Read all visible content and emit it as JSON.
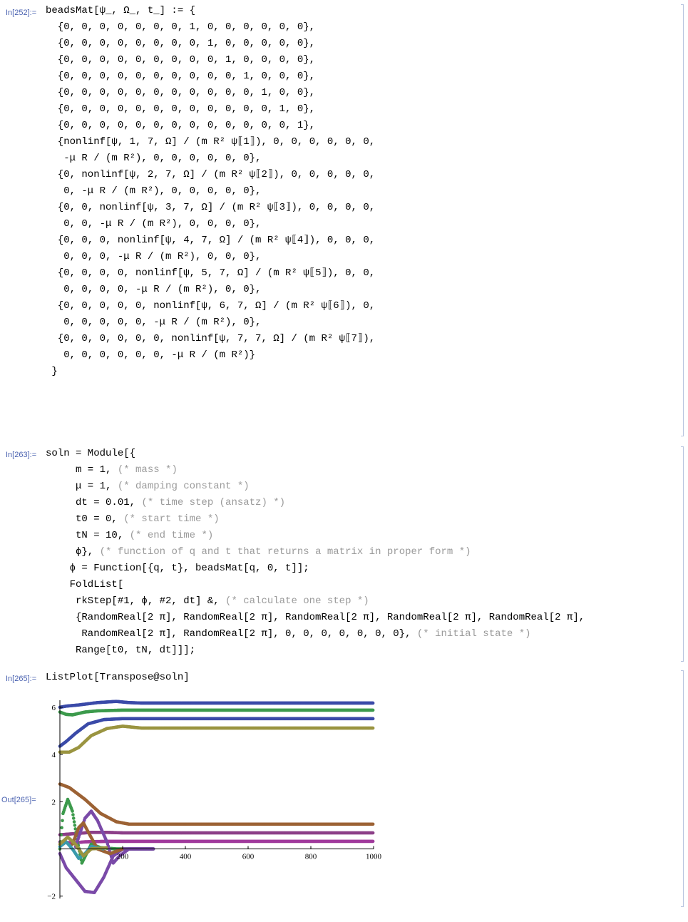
{
  "cells": [
    {
      "label": "In[252]:=",
      "lines": [
        "beadsMat[ψ_, Ω_, t_] := {",
        "  {0, 0, 0, 0, 0, 0, 0, 1, 0, 0, 0, 0, 0, 0},",
        "  {0, 0, 0, 0, 0, 0, 0, 0, 1, 0, 0, 0, 0, 0},",
        "  {0, 0, 0, 0, 0, 0, 0, 0, 0, 1, 0, 0, 0, 0},",
        "  {0, 0, 0, 0, 0, 0, 0, 0, 0, 0, 1, 0, 0, 0},",
        "  {0, 0, 0, 0, 0, 0, 0, 0, 0, 0, 0, 1, 0, 0},",
        "  {0, 0, 0, 0, 0, 0, 0, 0, 0, 0, 0, 0, 1, 0},",
        "  {0, 0, 0, 0, 0, 0, 0, 0, 0, 0, 0, 0, 0, 1},",
        "  {nonlinf[ψ, 1, 7, Ω] / (m R² ψ⟦1⟧), 0, 0, 0, 0, 0, 0,",
        "   -μ R / (m R²), 0, 0, 0, 0, 0, 0},",
        "  {0, nonlinf[ψ, 2, 7, Ω] / (m R² ψ⟦2⟧), 0, 0, 0, 0, 0,",
        "   0, -μ R / (m R²), 0, 0, 0, 0, 0},",
        "  {0, 0, nonlinf[ψ, 3, 7, Ω] / (m R² ψ⟦3⟧), 0, 0, 0, 0,",
        "   0, 0, -μ R / (m R²), 0, 0, 0, 0},",
        "  {0, 0, 0, nonlinf[ψ, 4, 7, Ω] / (m R² ψ⟦4⟧), 0, 0, 0,",
        "   0, 0, 0, -μ R / (m R²), 0, 0, 0},",
        "  {0, 0, 0, 0, nonlinf[ψ, 5, 7, Ω] / (m R² ψ⟦5⟧), 0, 0,",
        "   0, 0, 0, 0, -μ R / (m R²), 0, 0},",
        "  {0, 0, 0, 0, 0, nonlinf[ψ, 6, 7, Ω] / (m R² ψ⟦6⟧), 0,",
        "   0, 0, 0, 0, 0, -μ R / (m R²), 0},",
        "  {0, 0, 0, 0, 0, 0, nonlinf[ψ, 7, 7, Ω] / (m R² ψ⟦7⟧),",
        "   0, 0, 0, 0, 0, 0, -μ R / (m R²)}",
        " }"
      ]
    },
    {
      "label": "In[263]:=",
      "lines": [
        "soln = Module[{",
        "     m = 1, (* mass *)",
        "     μ = 1, (* damping constant *)",
        "     dt = 0.01, (* time step (ansatz) *)",
        "     t0 = 0, (* start time *)",
        "     tN = 10, (* end time *)",
        "     ϕ}, (* function of q and t that returns a matrix in proper form *)",
        "    ϕ = Function[{q, t}, beadsMat[q, 0, t]];",
        "    FoldList[",
        "     rkStep[#1, ϕ, #2, dt] &, (* calculate one step *)",
        "     {RandomReal[2 π], RandomReal[2 π], RandomReal[2 π], RandomReal[2 π], RandomReal[2 π],",
        "      RandomReal[2 π], RandomReal[2 π], 0, 0, 0, 0, 0, 0, 0}, (* initial state *)",
        "     Range[t0, tN, dt]]];"
      ]
    },
    {
      "label": "In[265]:=",
      "lines": [
        "ListPlot[Transpose@soln]"
      ]
    }
  ],
  "output_label": "Out[265]=",
  "chart_data": {
    "type": "scatter",
    "title": "",
    "xlabel": "",
    "ylabel": "",
    "xlim": [
      0,
      1000
    ],
    "ylim": [
      -2.1,
      6.3
    ],
    "x_ticks": [
      200,
      400,
      600,
      800,
      1000
    ],
    "y_ticks": [
      -2,
      2,
      4,
      6
    ],
    "x_tick_labels": [
      "200",
      "400",
      "600",
      "800",
      "1000"
    ],
    "y_tick_labels": [
      "−2",
      "2",
      "4",
      "6"
    ],
    "series": [
      {
        "color": "#3a4aa8",
        "points": [
          [
            0,
            6.0
          ],
          [
            20,
            6.05
          ],
          [
            60,
            6.1
          ],
          [
            120,
            6.2
          ],
          [
            180,
            6.25
          ],
          [
            220,
            6.2
          ],
          [
            260,
            6.18
          ],
          [
            400,
            6.18
          ],
          [
            1000,
            6.18
          ]
        ]
      },
      {
        "color": "#3c9a4c",
        "points": [
          [
            0,
            5.8
          ],
          [
            20,
            5.7
          ],
          [
            40,
            5.68
          ],
          [
            80,
            5.8
          ],
          [
            120,
            5.85
          ],
          [
            200,
            5.88
          ],
          [
            300,
            5.88
          ],
          [
            1000,
            5.88
          ]
        ]
      },
      {
        "color": "#3a4aa8",
        "points": [
          [
            0,
            4.35
          ],
          [
            20,
            4.55
          ],
          [
            50,
            4.9
          ],
          [
            90,
            5.3
          ],
          [
            140,
            5.48
          ],
          [
            200,
            5.52
          ],
          [
            300,
            5.52
          ],
          [
            1000,
            5.52
          ]
        ]
      },
      {
        "color": "#9a9440",
        "points": [
          [
            0,
            4.1
          ],
          [
            30,
            4.1
          ],
          [
            60,
            4.3
          ],
          [
            100,
            4.8
          ],
          [
            150,
            5.1
          ],
          [
            200,
            5.2
          ],
          [
            260,
            5.12
          ],
          [
            300,
            5.12
          ],
          [
            1000,
            5.12
          ]
        ]
      },
      {
        "color": "#9c6234",
        "points": [
          [
            0,
            2.75
          ],
          [
            30,
            2.6
          ],
          [
            80,
            2.1
          ],
          [
            130,
            1.5
          ],
          [
            180,
            1.15
          ],
          [
            220,
            1.05
          ],
          [
            300,
            1.05
          ],
          [
            1000,
            1.05
          ]
        ]
      },
      {
        "color": "#8c3f88",
        "points": [
          [
            0,
            0.6
          ],
          [
            50,
            0.65
          ],
          [
            100,
            0.7
          ],
          [
            150,
            0.7
          ],
          [
            200,
            0.68
          ],
          [
            300,
            0.68
          ],
          [
            1000,
            0.68
          ]
        ]
      },
      {
        "color": "#a03a9c",
        "points": [
          [
            0,
            0.3
          ],
          [
            40,
            0.25
          ],
          [
            80,
            0.3
          ],
          [
            150,
            0.32
          ],
          [
            250,
            0.32
          ],
          [
            1000,
            0.32
          ]
        ]
      },
      {
        "color": "#3c9a4c",
        "points": [
          [
            0,
            0.0
          ],
          [
            10,
            1.5
          ],
          [
            25,
            2.1
          ],
          [
            40,
            1.6
          ],
          [
            55,
            0.4
          ],
          [
            70,
            -0.6
          ],
          [
            85,
            -0.2
          ],
          [
            100,
            0.2
          ],
          [
            130,
            0.05
          ],
          [
            180,
            0.0
          ],
          [
            300,
            0.0
          ]
        ]
      },
      {
        "color": "#7a4aa8",
        "points": [
          [
            0,
            -0.2
          ],
          [
            20,
            -0.8
          ],
          [
            50,
            -1.3
          ],
          [
            80,
            -1.8
          ],
          [
            110,
            -1.85
          ],
          [
            140,
            -1.2
          ],
          [
            170,
            -0.3
          ],
          [
            200,
            0.0
          ],
          [
            300,
            0.0
          ]
        ]
      },
      {
        "color": "#7a4aa8",
        "points": [
          [
            50,
            0.1
          ],
          [
            80,
            1.3
          ],
          [
            100,
            1.6
          ],
          [
            120,
            1.2
          ],
          [
            150,
            0.3
          ],
          [
            170,
            -0.6
          ],
          [
            190,
            -0.3
          ],
          [
            220,
            0.0
          ],
          [
            300,
            0.0
          ]
        ]
      },
      {
        "color": "#9c6234",
        "points": [
          [
            40,
            0.2
          ],
          [
            60,
            0.9
          ],
          [
            75,
            1.1
          ],
          [
            95,
            0.6
          ],
          [
            120,
            0.0
          ],
          [
            160,
            -0.2
          ],
          [
            200,
            0.0
          ]
        ]
      },
      {
        "color": "#3a9aac",
        "points": [
          [
            0,
            0.1
          ],
          [
            20,
            0.3
          ],
          [
            40,
            0.0
          ],
          [
            60,
            -0.4
          ],
          [
            80,
            -0.2
          ],
          [
            100,
            0.1
          ],
          [
            140,
            0.0
          ]
        ]
      },
      {
        "color": "#9a9440",
        "points": [
          [
            0,
            0.2
          ],
          [
            25,
            0.5
          ],
          [
            50,
            0.2
          ],
          [
            75,
            -0.3
          ],
          [
            100,
            0.0
          ],
          [
            150,
            0.05
          ]
        ]
      }
    ]
  }
}
